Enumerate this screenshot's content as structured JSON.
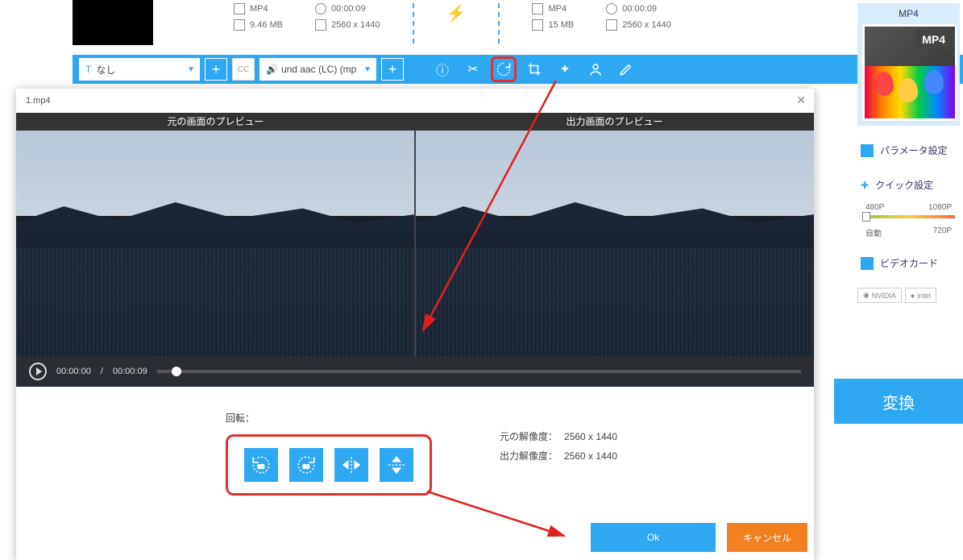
{
  "source": {
    "format": "MP4",
    "duration": "00:00:09",
    "size": "9.46 MB",
    "resolution": "2560 x 1440"
  },
  "output": {
    "format": "MP4",
    "duration": "00:00:09",
    "size": "15 MB",
    "resolution": "2560 x 1440"
  },
  "toolbar": {
    "subtitle_dd": "なし",
    "audio_dd": "und aac (LC) (mp",
    "cc": "CC"
  },
  "dialog": {
    "title": "1.mp4",
    "preview_left": "元の画面のプレビュー",
    "preview_right": "出力画面のプレビュー",
    "time_current": "00:00:00",
    "time_sep": "/",
    "time_total": "00:00:09",
    "rotate_label": "回転：",
    "source_res_label": "元の解像度：",
    "source_res": "2560 x 1440",
    "output_res_label": "出力解像度：",
    "output_res": "2560 x 1440",
    "ok": "Ok",
    "cancel": "キャンセル"
  },
  "sidebar": {
    "format": "MP4",
    "badge": "MP4",
    "param": "パラメータ設定",
    "quick": "クイック設定",
    "q480": "480P",
    "q1080": "1080P",
    "auto": "自動",
    "q720": "720P",
    "gpu": "ビデオカード",
    "nvidia": "NVIDIA",
    "intel": "intel",
    "convert": "変換"
  }
}
